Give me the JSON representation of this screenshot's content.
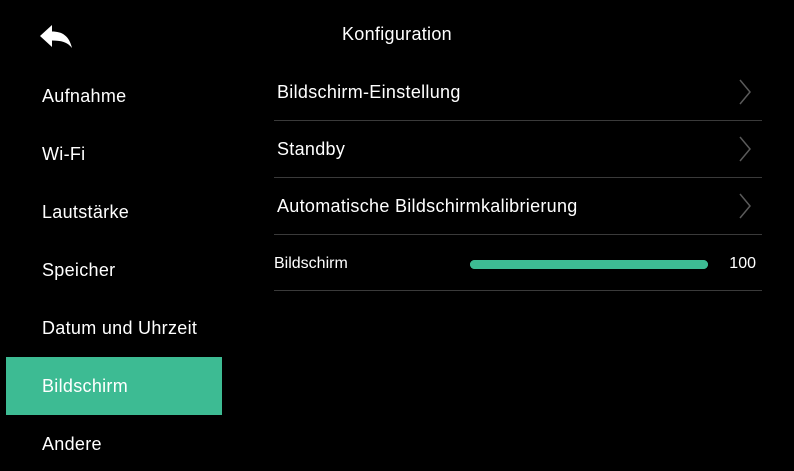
{
  "header": {
    "title": "Konfiguration",
    "back_icon": "back-arrow-icon"
  },
  "sidebar": {
    "items": [
      {
        "label": "Aufnahme",
        "active": false
      },
      {
        "label": "Wi-Fi",
        "active": false
      },
      {
        "label": "Lautstärke",
        "active": false
      },
      {
        "label": "Speicher",
        "active": false
      },
      {
        "label": "Datum und Uhrzeit",
        "active": false
      },
      {
        "label": "Bildschirm",
        "active": true
      },
      {
        "label": "Andere",
        "active": false
      }
    ]
  },
  "main": {
    "rows": [
      {
        "label": "Bildschirm-Einstellung",
        "icon": "chevron-right-icon"
      },
      {
        "label": "Standby",
        "icon": "chevron-right-icon"
      },
      {
        "label": "Automatische Bildschirmkalibrierung",
        "icon": "chevron-right-icon"
      }
    ],
    "brightness": {
      "label": "Bildschirm",
      "value": "100",
      "level": 1.0
    }
  },
  "colors": {
    "accent": "#3dbb93",
    "background": "#000000",
    "divider": "#3a3a3a",
    "text": "#ffffff"
  }
}
